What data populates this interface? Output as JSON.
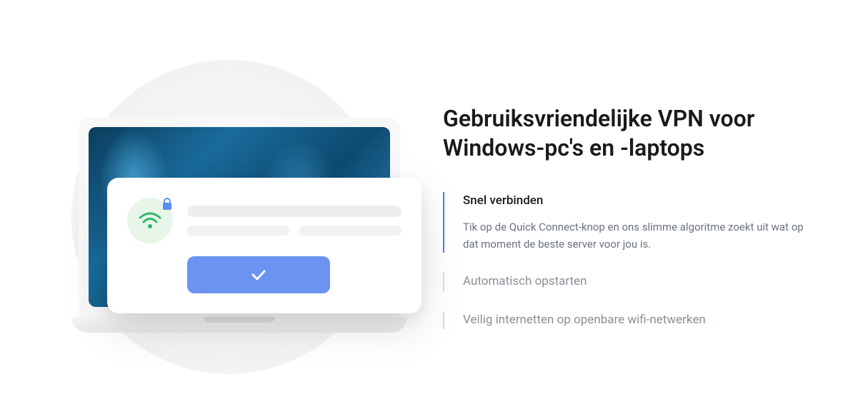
{
  "heading": "Gebruiksvriendelijke VPN voor Windows-pc's en -laptops",
  "features": [
    {
      "title": "Snel verbinden",
      "description": "Tik op de Quick Connect-knop en ons slimme algoritme zoekt uit wat op dat moment de beste server voor jou is.",
      "active": true
    },
    {
      "title": "Automatisch opstarten",
      "description": "",
      "active": false
    },
    {
      "title": "Veilig internetten op openbare wifi-netwerken",
      "description": "",
      "active": false
    }
  ]
}
